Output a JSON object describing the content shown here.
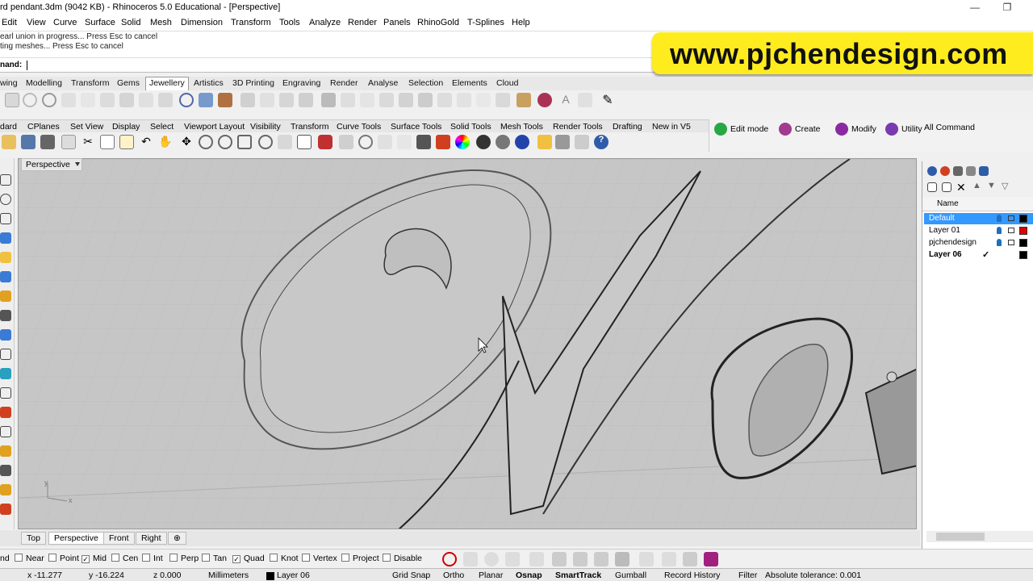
{
  "window": {
    "title": "rd pendant.3dm (9042 KB) - Rhinoceros 5.0 Educational - [Perspective]",
    "minimize": "—",
    "restore": "❐"
  },
  "menu": [
    "Edit",
    "View",
    "Curve",
    "Surface",
    "Solid",
    "Mesh",
    "Dimension",
    "Transform",
    "Tools",
    "Analyze",
    "Render",
    "Panels",
    "RhinoGold",
    "T-Splines",
    "Help"
  ],
  "history": [
    "earl union in progress... Press Esc to cancel",
    "ting meshes... Press Esc to cancel"
  ],
  "command": {
    "prompt": "nand:"
  },
  "banner": "www.pjchendesign.com",
  "tabs_row1": [
    "wing",
    "Modelling",
    "Transform",
    "Gems",
    "Jewellery",
    "Artistics",
    "3D Printing",
    "Engraving",
    "Render",
    "Analyse",
    "Selection",
    "Elements",
    "Cloud"
  ],
  "tabs_row1_active": "Jewellery",
  "tabs_row2": [
    "dard",
    "CPlanes",
    "Set View",
    "Display",
    "Select",
    "Viewport Layout",
    "Visibility",
    "Transform",
    "Curve Tools",
    "Surface Tools",
    "Solid Tools",
    "Mesh Tools",
    "Render Tools",
    "Drafting",
    "New in V5"
  ],
  "tsplines": {
    "edit": "Edit mode",
    "create": "Create",
    "modify": "Modify",
    "utility": "Utility",
    "all": "All Command"
  },
  "viewport": {
    "label": "Perspective",
    "axis_y": "y",
    "axis_x": "x"
  },
  "view_tabs": [
    "Top",
    "Perspective",
    "Front",
    "Right"
  ],
  "view_tabs_active": "Perspective",
  "add_view": "⊕",
  "osnaps": [
    {
      "label": "nd",
      "checked": false
    },
    {
      "label": "Near",
      "checked": false
    },
    {
      "label": "Point",
      "checked": false
    },
    {
      "label": "Mid",
      "checked": true
    },
    {
      "label": "Cen",
      "checked": false
    },
    {
      "label": "Int",
      "checked": false
    },
    {
      "label": "Perp",
      "checked": false
    },
    {
      "label": "Tan",
      "checked": false
    },
    {
      "label": "Quad",
      "checked": true
    },
    {
      "label": "Knot",
      "checked": false
    },
    {
      "label": "Vertex",
      "checked": false
    },
    {
      "label": "Project",
      "checked": false
    },
    {
      "label": "Disable",
      "checked": false
    }
  ],
  "status": {
    "x": "x -11.277",
    "y": "y -16.224",
    "z": "z 0.000",
    "units": "Millimeters",
    "layer": "Layer 06",
    "grid_snap": "Grid Snap",
    "ortho": "Ortho",
    "planar": "Planar",
    "osnap": "Osnap",
    "smarttrack": "SmartTrack",
    "gumball": "Gumball",
    "record": "Record History",
    "filter": "Filter",
    "tolerance": "Absolute tolerance: 0.001"
  },
  "layers": {
    "column": "Name",
    "rows": [
      {
        "name": "Default",
        "selected": true,
        "current": false,
        "color": "#000000"
      },
      {
        "name": "Layer 01",
        "selected": false,
        "current": false,
        "color": "#e00000"
      },
      {
        "name": "pjchendesign",
        "selected": false,
        "current": false,
        "color": "#000000"
      },
      {
        "name": "Layer 06",
        "selected": false,
        "current": true,
        "color": "#000000"
      }
    ],
    "check": "✓"
  }
}
